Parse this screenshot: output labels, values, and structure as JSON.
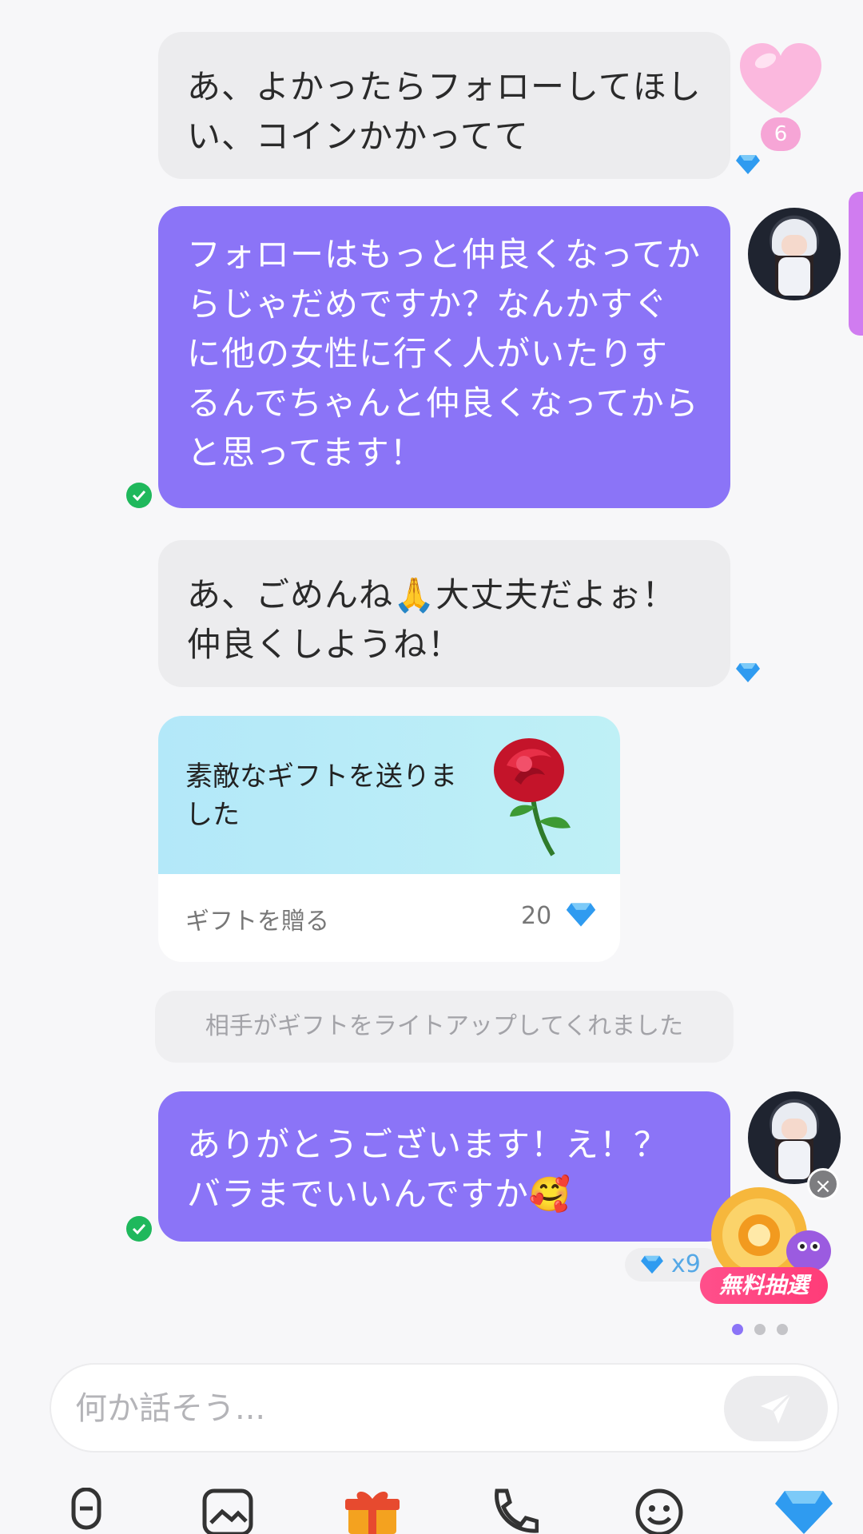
{
  "messages": [
    {
      "id": "m1",
      "side": "in",
      "text": "あ、よかったらフォローしてほしい、コインかかってて"
    },
    {
      "id": "m2",
      "side": "out",
      "text": "フォローはもっと仲良くなってからじゃだめですか？なんかすぐに他の女性に行く人がいたりするんでちゃんと仲良くなってからと思ってます！"
    },
    {
      "id": "m3",
      "side": "in",
      "text": "あ、ごめんね🙏大丈夫だよぉ！仲良くしようね！"
    },
    {
      "id": "m5",
      "side": "out",
      "text": "ありがとうございます！え！？バラまでいいんですか🥰"
    }
  ],
  "heart": {
    "count": "6"
  },
  "gift_card": {
    "title": "素敵なギフトを送りました",
    "action_label": "ギフトを贈る",
    "price": "20"
  },
  "system_notice": "相手がギフトをライトアップしてくれました",
  "diamond_reward": "x9",
  "lottery": {
    "label": "無料抽選",
    "close": "×"
  },
  "pagination": {
    "count": 3,
    "active": 0
  },
  "input": {
    "placeholder": "何か話そう..."
  },
  "toolbar": [
    "microphone-icon",
    "image-icon",
    "gift-icon",
    "phone-icon",
    "emoji-icon",
    "diamond-icon"
  ],
  "colors": {
    "accent": "#8b74f7",
    "incoming": "#ececee",
    "check": "#1fb85c"
  }
}
